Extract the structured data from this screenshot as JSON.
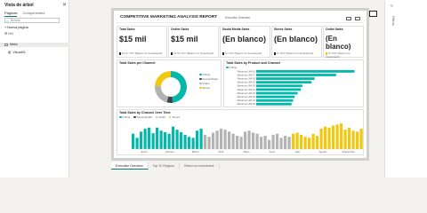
{
  "pane": {
    "title": "Vista de árbol",
    "tabs": [
      "Páginas",
      "Componentes"
    ],
    "search_placeholder": "Buscar",
    "new_page": "+ Nueva página",
    "add_label": "Nel",
    "rows": [
      "Meta",
      "Visual01"
    ]
  },
  "report": {
    "title": "COMPETITIVE MARKETING ANALYSIS REPORT",
    "subtitle": "Executive Overview",
    "cards": [
      {
        "title": "Total Sales",
        "value": "$15 mil",
        "foot": "12 % YOY (Return on Investment)"
      },
      {
        "title": "Online Sales",
        "value": "$15 mil",
        "foot": "12 % YOY (Return on Investment)"
      },
      {
        "title": "Social Media Sales",
        "value": "(En blanco)",
        "foot": "% YOY (Return on Investment)"
      },
      {
        "title": "Stores Sales",
        "value": "(En blanco)",
        "foot": "% YOY (Return on Investment)"
      },
      {
        "title": "Outlet Sales",
        "value": "(En blanco)",
        "foot": "% YOY (Return on Investment)"
      }
    ],
    "donut_title": "Total Sales per Channel",
    "donut_legend": [
      "Online",
      "Social Media",
      "Outlet",
      "Stores"
    ],
    "hbar_title": "Total Sales by Product and Channel",
    "hbar_legend": [
      "Online"
    ],
    "trend_title": "Total Sales by Channel Over Time",
    "trend_legend": [
      "Online",
      "Social Media",
      "Outlet",
      "Stores"
    ]
  },
  "colors": {
    "online": "#01b8aa",
    "social": "#374649",
    "outlet": "#b3b3b3",
    "stores": "#f2c80f",
    "accent": "#117865"
  },
  "chart_data": [
    {
      "type": "pie",
      "title": "Total Sales per Channel",
      "categories": [
        "Online",
        "Social Media",
        "Outlet",
        "Stores"
      ],
      "values": [
        48,
        6,
        22,
        24
      ]
    },
    {
      "type": "bar",
      "title": "Total Sales by Product and Channel",
      "categories": [
        "Maximus UM-16",
        "Maximus UM-17",
        "Maximus UM-18",
        "Maximus UM-19",
        "Maximus UM-20",
        "Maximus UM-21",
        "Maximus UM-22",
        "Maximus UM-23",
        "Maximus UM-24",
        "Maximus UM-25"
      ],
      "series": [
        {
          "name": "Online",
          "values": [
            3.2,
            2.6,
            1.9,
            1.8,
            1.5,
            1.45,
            1.35,
            1.25,
            1.2,
            1.15
          ]
        }
      ]
    },
    {
      "type": "bar",
      "title": "Total Sales by Channel Over Time",
      "x": [
        "Enero",
        "Febrero",
        "Marzo",
        "Abril",
        "Mayo",
        "Junio",
        "Julio",
        "Agosto",
        "Septiembre"
      ],
      "series": [
        {
          "name": "Online",
          "values": [
            30,
            22,
            34,
            40,
            42,
            31,
            42,
            36,
            33,
            30,
            44,
            38,
            33,
            28,
            24,
            22,
            36,
            40
          ]
        },
        {
          "name": "Outlet",
          "values": [
            28,
            24,
            32,
            36,
            40,
            38,
            34,
            30,
            26,
            24,
            34,
            36,
            32,
            30,
            24,
            26,
            18,
            28,
            30,
            22,
            26,
            24
          ]
        },
        {
          "name": "Stores",
          "values": [
            30,
            32,
            28,
            24,
            22,
            30,
            26,
            40,
            44,
            42,
            46,
            48,
            50,
            38,
            42,
            36,
            34,
            40
          ]
        }
      ]
    }
  ],
  "page_tabs": [
    "Executive Overview",
    "Top 10 Regions",
    "Return on Investment"
  ],
  "side_panel": {
    "label": "Filtros"
  }
}
